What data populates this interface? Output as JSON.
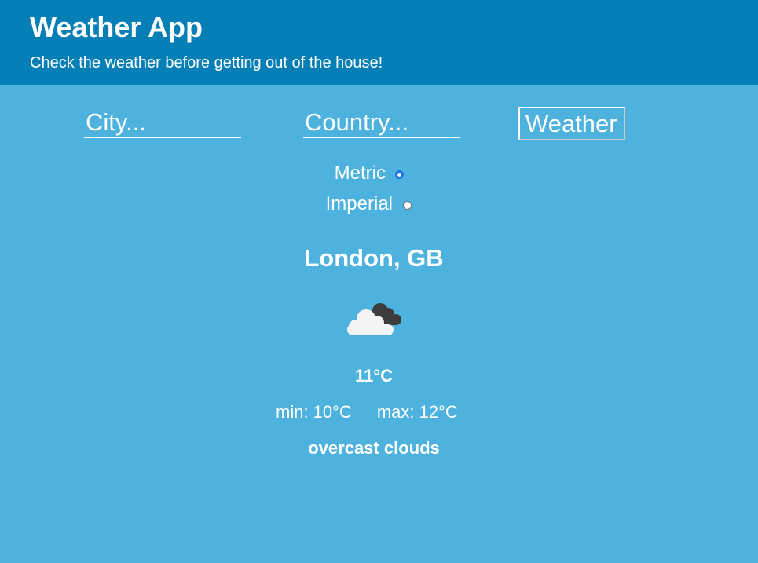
{
  "header": {
    "title": "Weather App",
    "subtitle": "Check the weather before getting out of the house!"
  },
  "search": {
    "city_placeholder": "City...",
    "country_placeholder": "Country...",
    "submit_label": "Weather"
  },
  "units": {
    "options": [
      {
        "label": "Metric",
        "selected": true
      },
      {
        "label": "Imperial",
        "selected": false
      }
    ]
  },
  "result": {
    "location": "London, GB",
    "icon": "overcast-clouds-icon",
    "temperature": "11°C",
    "min": "min: 10°C",
    "max": "max: 12°C",
    "description": "overcast clouds"
  },
  "colors": {
    "background": "#4db2de",
    "header": "#067fb6",
    "text": "#ffffff",
    "radio_accent": "#1a73e8"
  }
}
